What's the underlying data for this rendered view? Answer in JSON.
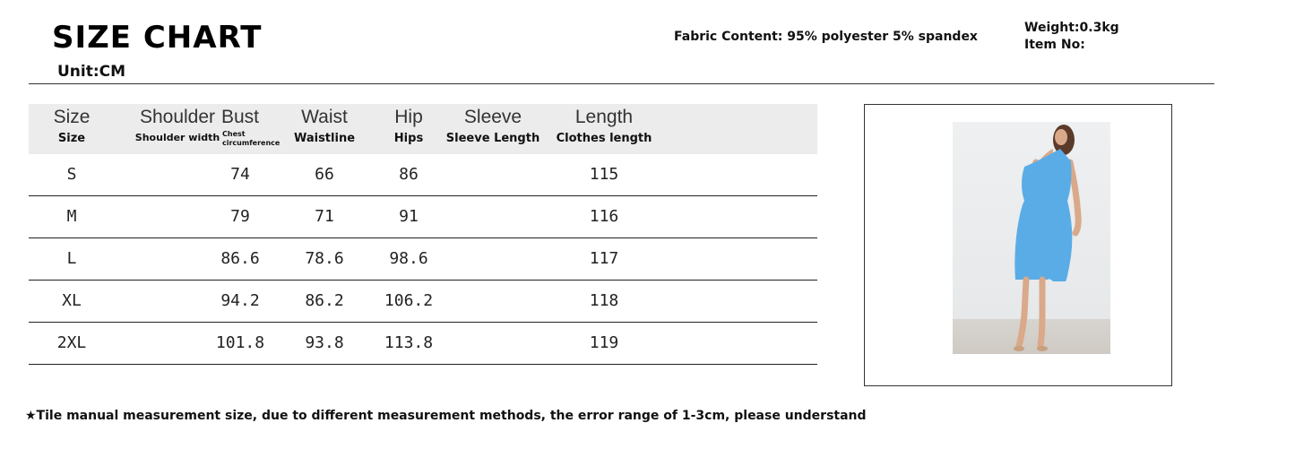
{
  "header": {
    "title": "SIZE CHART",
    "fabric": "Fabric Content: 95% polyester 5% spandex",
    "weight": "Weight:0.3kg",
    "item_no": "Item No:",
    "unit": "Unit:CM"
  },
  "table": {
    "columns": [
      {
        "en": "Size",
        "sub": "Size"
      },
      {
        "en": "Shoulder",
        "sub": "Shoulder width"
      },
      {
        "en": "Bust",
        "sub": "Chest circumference"
      },
      {
        "en": "Waist",
        "sub": "Waistline"
      },
      {
        "en": "Hip",
        "sub": "Hips"
      },
      {
        "en": "Sleeve",
        "sub": "Sleeve Length"
      },
      {
        "en": "Length",
        "sub": "Clothes length"
      }
    ],
    "rows": [
      {
        "size": "S",
        "shoulder": "",
        "bust": "74",
        "waist": "66",
        "hip": "86",
        "sleeve": "",
        "length": "115"
      },
      {
        "size": "M",
        "shoulder": "",
        "bust": "79",
        "waist": "71",
        "hip": "91",
        "sleeve": "",
        "length": "116"
      },
      {
        "size": "L",
        "shoulder": "",
        "bust": "86.6",
        "waist": "78.6",
        "hip": "98.6",
        "sleeve": "",
        "length": "117"
      },
      {
        "size": "XL",
        "shoulder": "",
        "bust": "94.2",
        "waist": "86.2",
        "hip": "106.2",
        "sleeve": "",
        "length": "118"
      },
      {
        "size": "2XL",
        "shoulder": "",
        "bust": "101.8",
        "waist": "93.8",
        "hip": "113.8",
        "sleeve": "",
        "length": "119"
      }
    ]
  },
  "colors": {
    "dress": "#5aace6",
    "header_bg": "#ececec"
  },
  "footer": {
    "note": "★Tile manual measurement size, due to different measurement methods, the error range of 1-3cm, please understand"
  }
}
